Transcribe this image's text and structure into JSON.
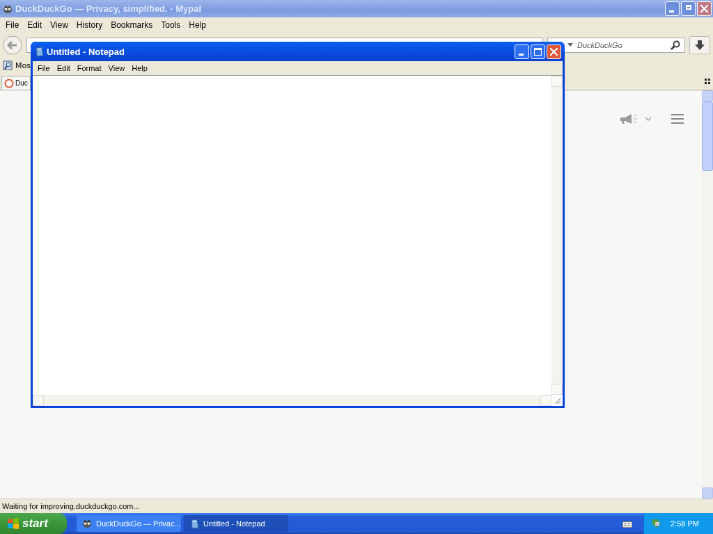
{
  "browser": {
    "title": "DuckDuckGo — Privacy, simplified. - Mypal",
    "menu": [
      "File",
      "Edit",
      "View",
      "History",
      "Bookmarks",
      "Tools",
      "Help"
    ],
    "search": {
      "placeholder": "DuckDuckGo"
    },
    "bookmarks": [
      "Mos"
    ],
    "tabs": [
      {
        "label": "Duc",
        "selected": true
      }
    ],
    "status_bar": "Waiting for improving.duckduckgo.com..."
  },
  "notepad": {
    "title": "Untitled - Notepad",
    "menu": [
      "File",
      "Edit",
      "Format",
      "View",
      "Help"
    ]
  },
  "taskbar": {
    "start": "start",
    "items": [
      {
        "label": "DuckDuckGo — Privac...",
        "selected": false,
        "kind": "browser"
      },
      {
        "label": "Untitled - Notepad",
        "selected": true,
        "kind": "notepad"
      }
    ],
    "clock": "2:58 PM"
  }
}
